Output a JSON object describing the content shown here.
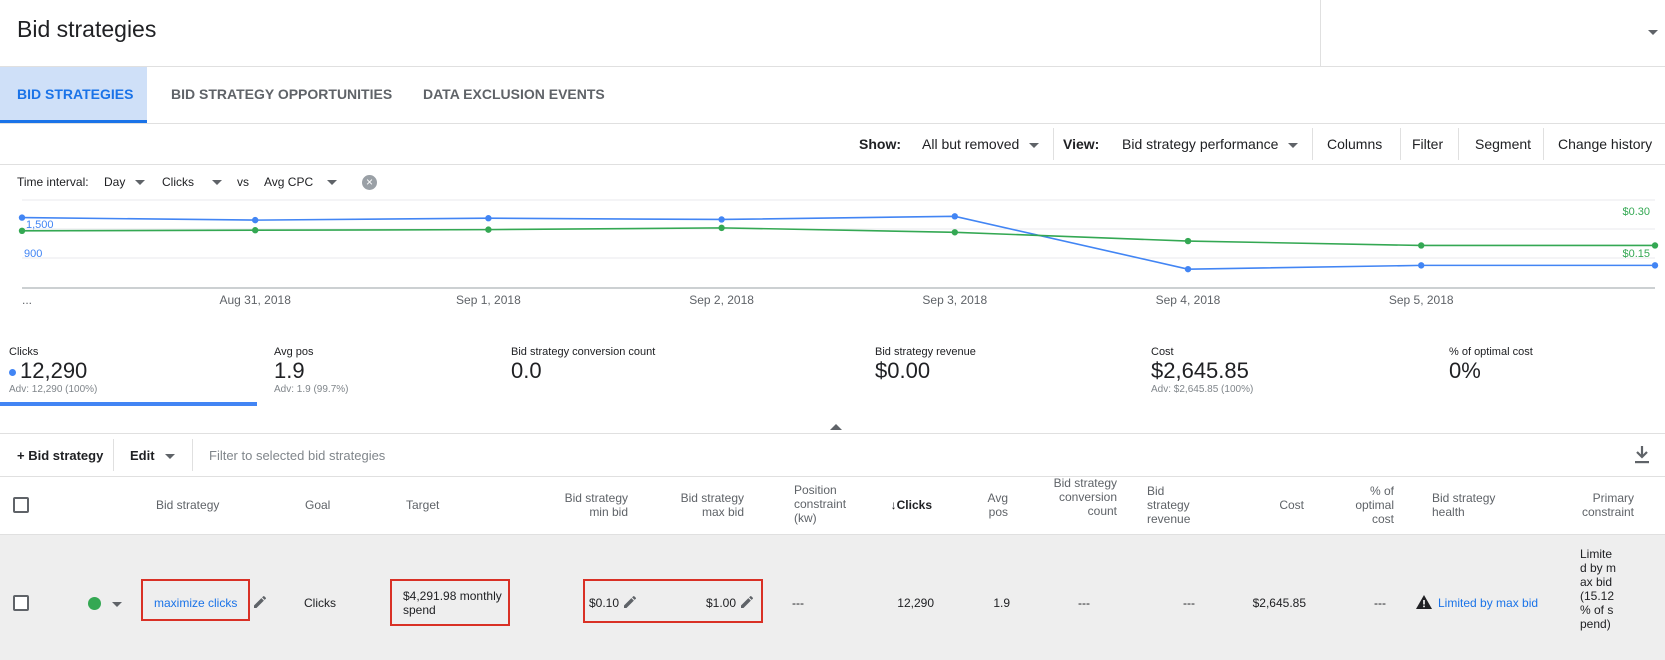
{
  "page": {
    "title": "Bid strategies"
  },
  "tabs": [
    {
      "label": "BID STRATEGIES",
      "active": true
    },
    {
      "label": "BID STRATEGY OPPORTUNITIES",
      "active": false
    },
    {
      "label": "DATA EXCLUSION EVENTS",
      "active": false
    }
  ],
  "toolbar": {
    "show_label": "Show:",
    "show_value": "All but removed",
    "view_label": "View:",
    "view_value": "Bid strategy performance",
    "columns": "Columns",
    "filter": "Filter",
    "segment": "Segment",
    "change_history": "Change history"
  },
  "chart_controls": {
    "time_interval_label": "Time interval:",
    "interval": "Day",
    "metric1": "Clicks",
    "vs": "vs",
    "metric2": "Avg CPC"
  },
  "chart_data": {
    "type": "line",
    "x": [
      "...",
      "Aug 31, 2018",
      "Sep 1, 2018",
      "Sep 2, 2018",
      "Sep 3, 2018",
      "Sep 4, 2018",
      "Sep 5, 2018"
    ],
    "left_ticks": [
      "1,500",
      "900"
    ],
    "right_ticks": [
      "$0.30",
      "$0.15"
    ],
    "series": [
      {
        "metric": "Clicks",
        "color": "#4285f4",
        "axis": "left",
        "values": [
          1720,
          1680,
          1710,
          1690,
          1740,
          900,
          960,
          960
        ]
      },
      {
        "metric": "Avg CPC",
        "color": "#34a853",
        "axis": "right",
        "values": [
          0.245,
          0.247,
          0.249,
          0.255,
          0.24,
          0.21,
          0.195,
          0.195
        ]
      }
    ],
    "left_ylim": [
      600,
      2000
    ],
    "right_ylim": [
      0.05,
      0.35
    ]
  },
  "stats": [
    {
      "label": "Clicks",
      "value": "12,290",
      "adv": "Adv: 12,290 (100%)"
    },
    {
      "label": "Avg pos",
      "value": "1.9",
      "adv": "Adv: 1.9 (99.7%)"
    },
    {
      "label": "Bid strategy conversion count",
      "value": "0.0",
      "adv": ""
    },
    {
      "label": "Bid strategy revenue",
      "value": "$0.00",
      "adv": ""
    },
    {
      "label": "Cost",
      "value": "$2,645.85",
      "adv": "Adv: $2,645.85 (100%)"
    },
    {
      "label": "% of optimal cost",
      "value": "0%",
      "adv": ""
    }
  ],
  "table_toolbar": {
    "add": "+ Bid strategy",
    "edit": "Edit",
    "filter_placeholder": "Filter to selected bid strategies"
  },
  "table": {
    "headers": {
      "bid_strategy": "Bid strategy",
      "goal": "Goal",
      "target": "Target",
      "min_bid": "Bid strategy min bid",
      "max_bid": "Bid strategy max bid",
      "position": "Position constraint (kw)",
      "clicks": "Clicks",
      "avg_pos": "Avg pos",
      "conv_count": "Bid strategy conversion count",
      "revenue": "Bid strategy revenue",
      "cost": "Cost",
      "pct_optimal": "% of optimal cost",
      "health": "Bid strategy health",
      "primary": "Primary constraint"
    },
    "row": {
      "status_color": "#34a853",
      "bid_strategy": "maximize clicks",
      "goal": "Clicks",
      "target": "$4,291.98 monthly spend",
      "min_bid": "$0.10",
      "max_bid": "$1.00",
      "position": "---",
      "clicks": "12,290",
      "avg_pos": "1.9",
      "conv_count": "---",
      "revenue": "---",
      "cost": "$2,645.85",
      "pct_optimal": "---",
      "health": "Limited by max bid",
      "primary": "Limited by max bid (15.12 % of spend)"
    }
  }
}
